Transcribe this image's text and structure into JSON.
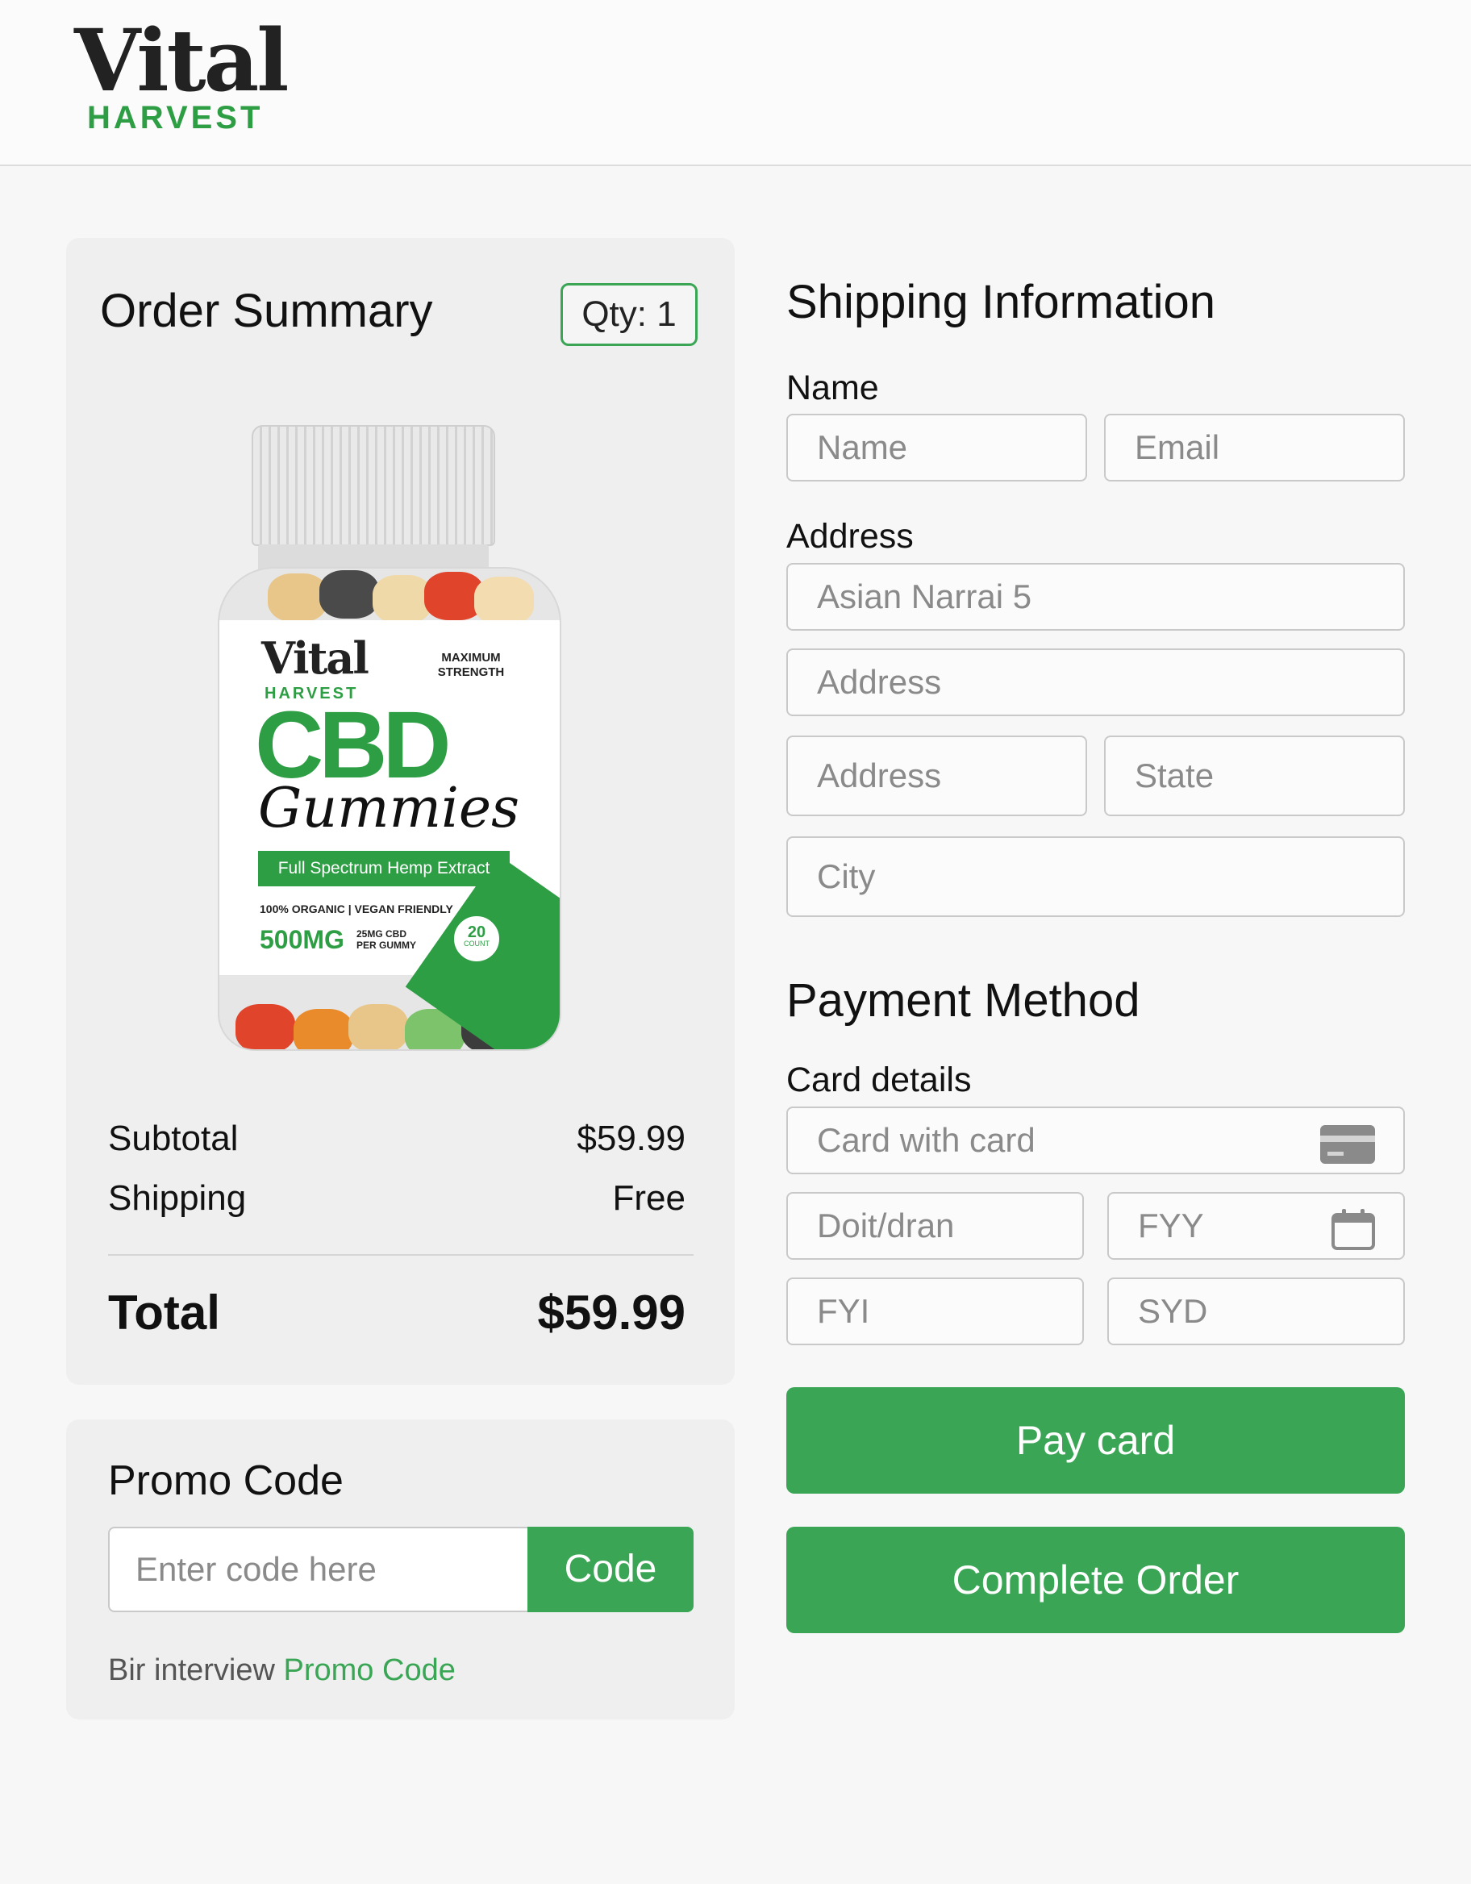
{
  "brand": {
    "name_top": "Vital",
    "name_bottom": "HARVEST",
    "accent_color": "#3aa655"
  },
  "order_summary": {
    "title": "Order Summary",
    "qty_badge": "Qty: 1",
    "product_label": {
      "brand_top": "Vital",
      "brand_bottom": "HARVEST",
      "strength": "MAXIMUM STRENGTH",
      "headline": "CBD",
      "script": "Gummies",
      "extract": "Full Spectrum Hemp Extract",
      "claims": "100% ORGANIC | VEGAN FRIENDLY",
      "dose": "500MG",
      "per_gummy": "25MG CBD PER GUMMY",
      "count_number": "20",
      "count_label": "COUNT"
    },
    "subtotal_label": "Subtotal",
    "subtotal_value": "$59.99",
    "shipping_label": "Shipping",
    "shipping_value": "Free",
    "total_label": "Total",
    "total_value": "$59.99"
  },
  "promo": {
    "title": "Promo Code",
    "input_placeholder": "Enter code here",
    "button_label": "Code",
    "note_text": "Bir interview",
    "note_link": "Promo Code"
  },
  "shipping": {
    "title": "Shipping Information",
    "name_label": "Name",
    "name_placeholder": "Name",
    "email_placeholder": "Email",
    "address_label": "Address",
    "address_line1_value": "Asian Narrai 5",
    "address_line2_placeholder": "Address",
    "address_line3_placeholder": "Address",
    "state_placeholder": "State",
    "city_placeholder": "City"
  },
  "payment": {
    "title": "Payment Method",
    "card_details_label": "Card details",
    "card_placeholder": "Card with card",
    "date_placeholder": "Doit/dran",
    "year_placeholder": "FYY",
    "fyi_placeholder": "FYI",
    "syd_placeholder": "SYD",
    "card_icon": "credit-card-icon",
    "calendar_icon": "calendar-icon",
    "pay_button": "Pay card",
    "complete_button": "Complete Order"
  }
}
